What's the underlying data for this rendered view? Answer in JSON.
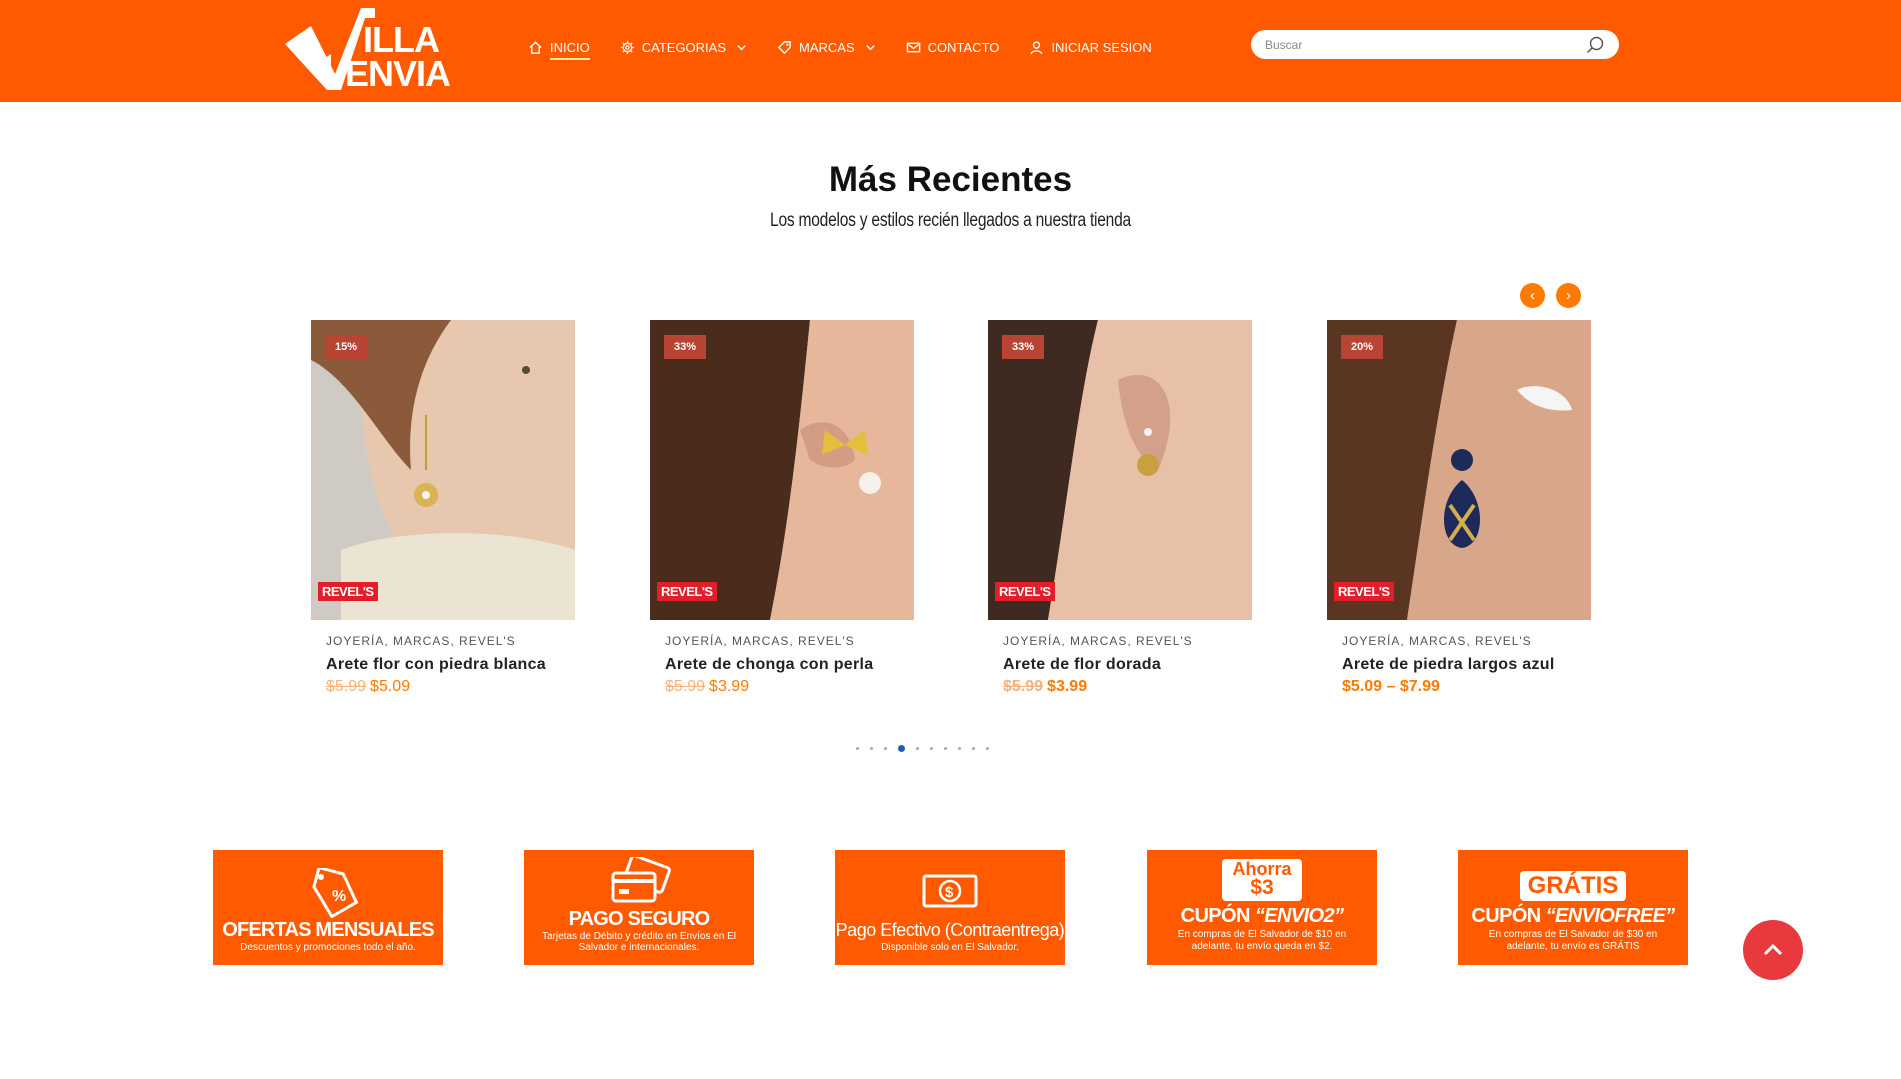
{
  "header": {
    "logo_text": "VILLA ENVIA",
    "nav": [
      {
        "label": "INICIO",
        "icon": "home-icon",
        "dropdown": false
      },
      {
        "label": "CATEGORIAS",
        "icon": "gear-icon",
        "dropdown": true
      },
      {
        "label": "MARCAS",
        "icon": "tag-icon",
        "dropdown": true
      },
      {
        "label": "CONTACTO",
        "icon": "mail-icon",
        "dropdown": false
      },
      {
        "label": "INICIAR SESION",
        "icon": "user-icon",
        "dropdown": false
      }
    ],
    "search_placeholder": "Buscar"
  },
  "section": {
    "title": "Más Recientes",
    "subtitle": "Los modelos y estilos recién llegados a nuestra tienda",
    "prev_arrow": "‹",
    "next_arrow": "›"
  },
  "products": [
    {
      "badge": "15%",
      "brand_label": "REVEL'S",
      "categories": "JOYERÍA, MARCAS, REVEL'S",
      "name": "Arete flor con piedra blanca",
      "old_price": "$5.99",
      "price": "$5.09"
    },
    {
      "badge": "33%",
      "brand_label": "REVEL'S",
      "categories": "JOYERÍA, MARCAS, REVEL'S",
      "name": "Arete de chonga con perla",
      "old_price": "$5.99",
      "price": "$3.99"
    },
    {
      "badge": "33%",
      "brand_label": "REVEL'S",
      "categories": "JOYERÍA, MARCAS, REVEL'S",
      "name": "Arete de flor dorada",
      "old_price": "$5.99",
      "price": "$3.99"
    },
    {
      "badge": "20%",
      "brand_label": "REVEL'S",
      "categories": "JOYERÍA, MARCAS, REVEL'S",
      "name": "Arete de piedra largos azul",
      "old_price": "",
      "price": "$5.09 – $7.99"
    }
  ],
  "carousel": {
    "total_dots": 10,
    "active_index": 3
  },
  "banners": [
    {
      "title": "OFERTAS MENSUALES",
      "subtitle": "Descuentos y promociones todo el año.",
      "icon": "discount-tag-icon"
    },
    {
      "title": "PAGO SEGURO",
      "subtitle": "Tarjetas de Débito y crédito en Envíos en El Salvador e internacionales.",
      "icon": "credit-card-icon"
    },
    {
      "title": "Pago Efectivo (Contraentrega)",
      "subtitle": "Disponible solo en El Salvador.",
      "icon": "cash-icon"
    },
    {
      "pill_top": "Ahorra",
      "pill_main": "$3",
      "title_prefix": "CUPÓN",
      "title_code": "“ENVIO2”",
      "subtitle": "En compras de El Salvador de $10 en adelante, tu envío queda en $2."
    },
    {
      "pill_main": "GRÁTIS",
      "title_prefix": "CUPÓN",
      "title_code": "“ENVIOFREE”",
      "subtitle": "En compras de El Salvador de $30 en adelante, tu envío es GRÁTIS"
    }
  ],
  "colors": {
    "brand": "#ff5a00",
    "price": "#ff7a00",
    "badge": "#b84433",
    "to_top": "#e8393f",
    "dot_active": "#1e60a8"
  }
}
